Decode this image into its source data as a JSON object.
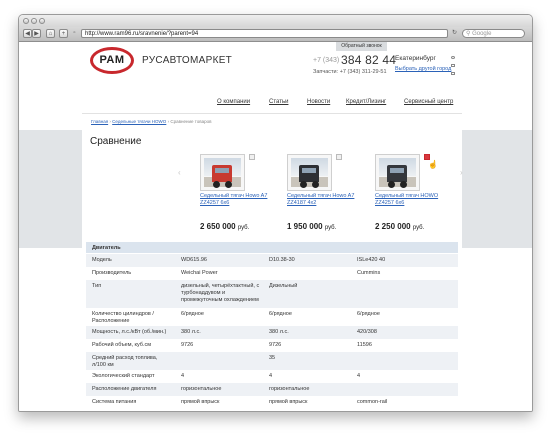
{
  "browser": {
    "url": "http://www.ram96.ru/sravnenie/?parent=94",
    "search_placeholder": "Google"
  },
  "header": {
    "logo_text": "РАМ",
    "brand": "РУСАВТОМАРКЕТ",
    "callback": "Обратный звонок",
    "phone_prefix": "+7 (343)",
    "phone_main": "384 82 44",
    "parts_label": "Запчасти:",
    "parts_phone": "+7 (343) 311-29-51",
    "city": "Екатеринбург",
    "other_city": "Выбрать другой город"
  },
  "nav": [
    "О компании",
    "Статьи",
    "Новости",
    "Кредит/Лизинг",
    "Сервисный центр"
  ],
  "breadcrumbs": {
    "home": "Главная",
    "section": "Седельные тягачи HOWO",
    "current": "Сравнение товаров",
    "sep": "›"
  },
  "page_title": "Сравнение",
  "products": [
    {
      "name": "Седельный тягач Howo A7 ZZ4257 6x6",
      "price": "2 650 000",
      "currency": "руб.",
      "cab_color": "#c83a30",
      "in_compare": false
    },
    {
      "name": "Седельный тягач Howo A7 ZZ4187 4x2",
      "price": "1 950 000",
      "currency": "руб.",
      "cab_color": "#2d2f33",
      "in_compare": false
    },
    {
      "name": "Седельный тягач HOWO ZZ4257 6x6",
      "price": "2 250 000",
      "currency": "руб.",
      "cab_color": "#34373c",
      "in_compare": true
    }
  ],
  "spec_group": "Двигатель",
  "specs": [
    {
      "label": "Модель",
      "values": [
        "WD615.96",
        "D10.38-30",
        "ISLe420 40"
      ]
    },
    {
      "label": "Производитель",
      "values": [
        "Weichai Power",
        "",
        "Cummins"
      ]
    },
    {
      "label": "Тип",
      "values": [
        "дизельный, четырёхтактный, с турбонаддувом и промежуточным охлаждением",
        "Дизельный",
        ""
      ]
    },
    {
      "label": "Количество цилиндров / Расположение",
      "values": [
        "6/рядное",
        "6/рядное",
        "6/рядное"
      ]
    },
    {
      "label": "Мощность, л.с./кВт (об./мин.)",
      "values": [
        "380 л.с.",
        "380 л.с.",
        "420/308"
      ]
    },
    {
      "label": "Рабочий объем, куб.см",
      "values": [
        "9726",
        "9726",
        "11596"
      ]
    },
    {
      "label": "Средний расход топлива, л/100 км",
      "values": [
        "",
        "35",
        ""
      ]
    },
    {
      "label": "Экологический стандарт",
      "values": [
        "4",
        "4",
        "4"
      ]
    },
    {
      "label": "Расположение двигателя",
      "values": [
        "горизонтальное",
        "горизонтальное",
        ""
      ]
    },
    {
      "label": "Система питания",
      "values": [
        "прямой впрыск",
        "прямой впрыск",
        "common-rail"
      ]
    }
  ]
}
